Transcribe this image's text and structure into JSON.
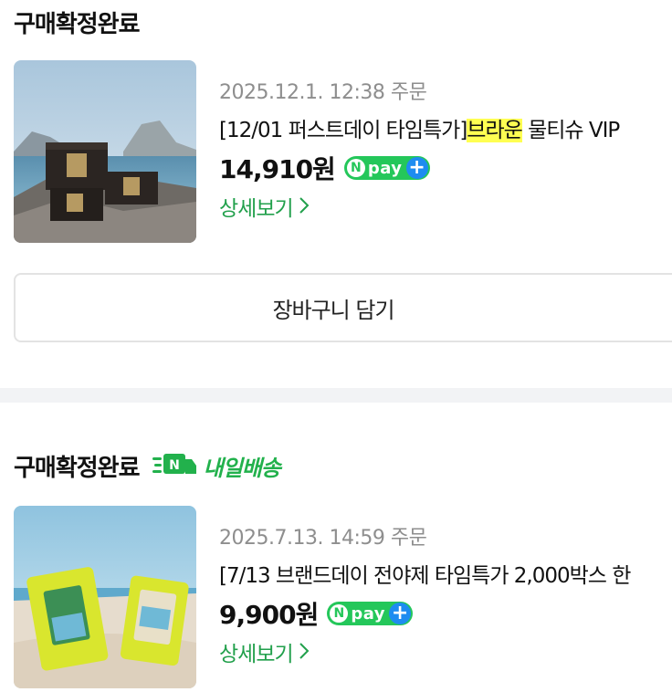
{
  "orders": [
    {
      "status": "구매확정완료",
      "delivery_label": "",
      "date": "2025.12.1. 12:38 주문",
      "title_prefix": "[12/01 퍼스트데이 타임특가]",
      "title_highlight": "브라운",
      "title_suffix": " 물티슈 VIP",
      "price": "14,910원",
      "detail_label": "상세보기",
      "cart_label": "장바구니 담기"
    },
    {
      "status": "구매확정완료",
      "delivery_label": "내일배송",
      "date": "2025.7.13. 14:59 주문",
      "title_prefix": "[7/13 브랜드데이 전야제 타임특가 2,000박스 한",
      "title_highlight": "",
      "title_suffix": "",
      "price": "9,900원",
      "detail_label": "상세보기"
    }
  ],
  "npay": {
    "text": "pay",
    "n": "N",
    "plus": "+"
  },
  "colors": {
    "accent_green": "#22a04c",
    "highlight": "#ffff52",
    "npay_green": "#24c75a",
    "npay_blue": "#1e8cf0"
  }
}
